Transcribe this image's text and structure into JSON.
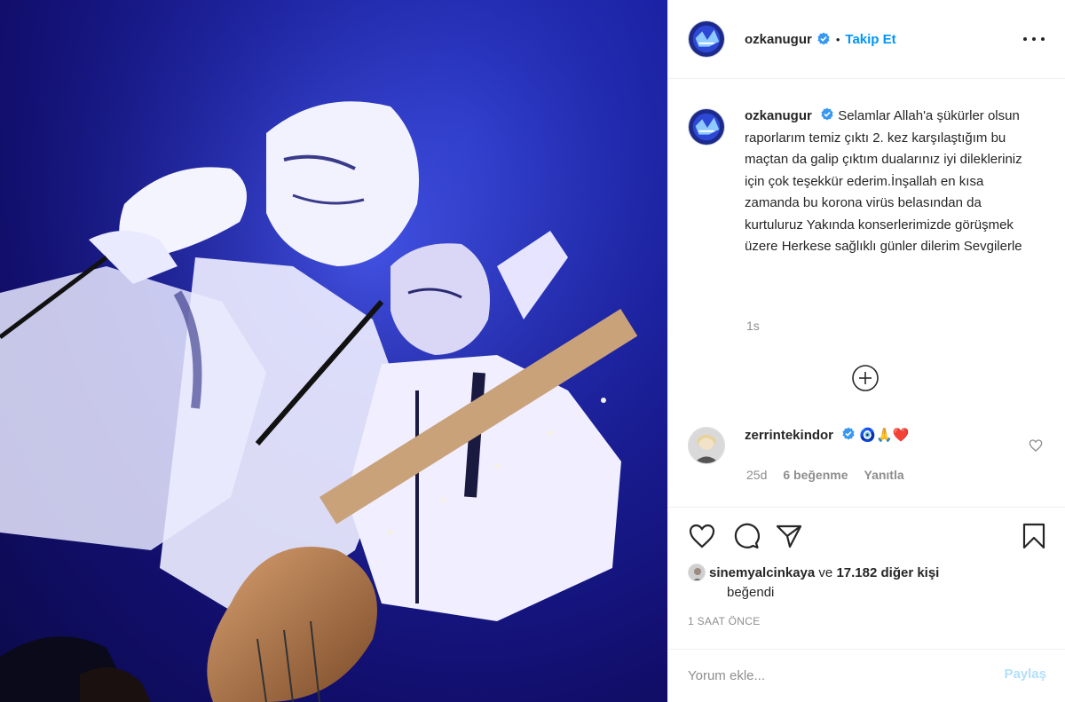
{
  "post": {
    "author": "ozkanugur",
    "follow_label": "Takip Et",
    "dot": "•",
    "more_icon": "more-horizontal-icon",
    "image_alt": "concert-photo"
  },
  "caption": {
    "author": "ozkanugur",
    "text": "Selamlar Allah'a şükürler olsun raporlarım temiz çıktı 2. kez karşılaştığım bu maçtan da galip çıktım dualarınız iyi dilekleriniz için çok teşekkür ederim.İnşallah en kısa zamanda bu korona virüs belasından da kurtuluruz Yakında konserlerimizde görüşmek üzere Herkese sağlıklı günler dilerim Sevgilerle",
    "age": "1s"
  },
  "comment": {
    "author": "zerrintekindor",
    "emoji": "🧿🙏❤️",
    "age": "25d",
    "likes": "6 beğenme",
    "reply": "Yanıtla"
  },
  "likes": {
    "user": "sinemyalcinkaya",
    "connector": "ve",
    "others": "17.182 diğer kişi",
    "liked": "beğendi"
  },
  "timestamp": "1 SAAT ÖNCE",
  "add_comment": {
    "placeholder": "Yorum ekle...",
    "post_label": "Paylaş"
  },
  "colors": {
    "accent": "#0095f6",
    "verified": "#3897f0",
    "muted": "#8e8e8e",
    "post_disabled": "#b2dffc"
  }
}
